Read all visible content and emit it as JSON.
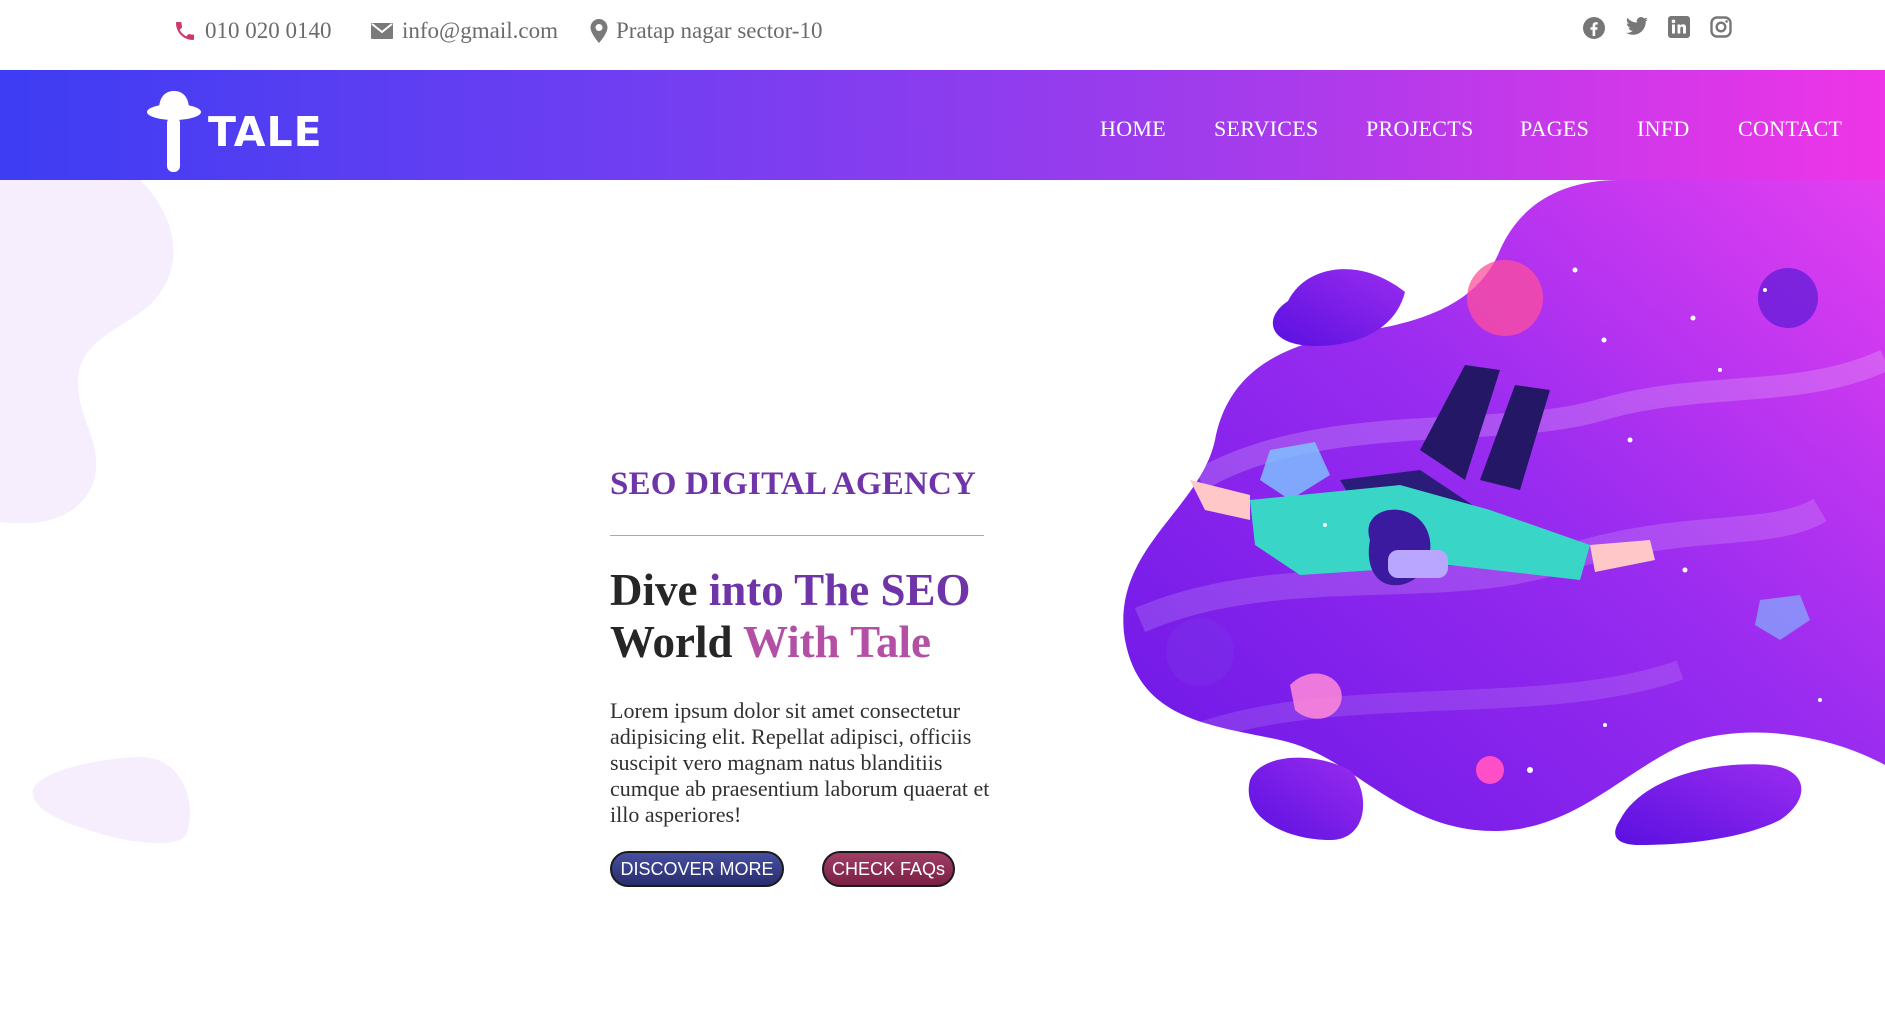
{
  "topbar": {
    "phone": "010 020 0140",
    "email": "info@gmail.com",
    "address": "Pratap nagar sector-10",
    "icons": [
      "phone-icon",
      "envelope-icon",
      "map-pin-icon"
    ],
    "social": [
      "facebook-icon",
      "twitter-icon",
      "linkedin-icon",
      "instagram-icon"
    ]
  },
  "brand": {
    "name": "TALE"
  },
  "nav": {
    "items": [
      "HOME",
      "SERVICES",
      "PROJECTS",
      "PAGES",
      "INFD",
      "CONTACT"
    ]
  },
  "hero": {
    "subtitle": "SEO DIGITAL AGENCY",
    "title": {
      "w1": "Dive",
      "w2": "into The SEO",
      "w3": "World",
      "w4": "With Tale"
    },
    "description": "Lorem ipsum dolor sit amet consectetur adipisicing elit. Repellat adipisci, officiis suscipit vero magnam natus blanditiis cumque ab praesentium laborum quaerat et illo asperiores!",
    "primary_button": "DISCOVER MORE",
    "secondary_button": "CHECK FAQs"
  },
  "colors": {
    "nav_gradient_start": "#3d3df3",
    "nav_gradient_end": "#ee35e7",
    "accent_purple": "#6f35a8",
    "accent_pink": "#b34fa4",
    "phone_icon": "#d1366f",
    "blob_light": "#f6edfd"
  }
}
